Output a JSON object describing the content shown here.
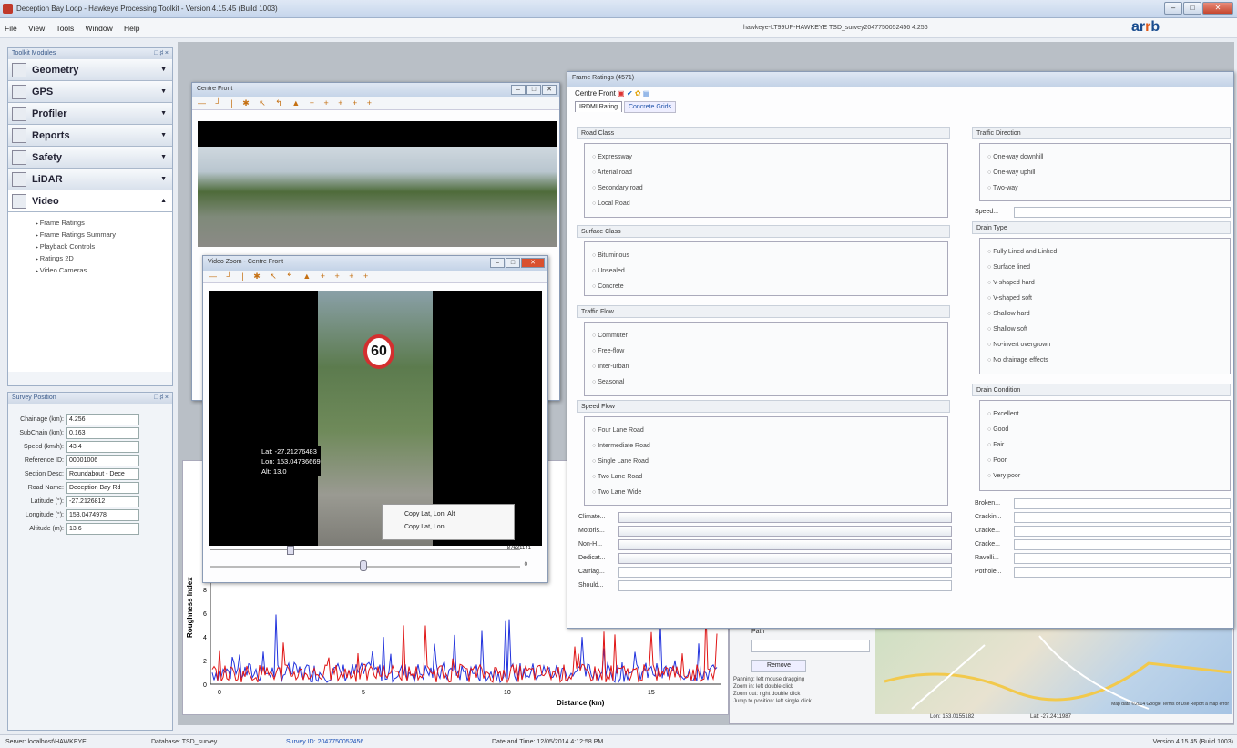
{
  "app": {
    "title": "Deception Bay Loop - Hawkeye Processing Toolkit - Version 4.15.45 (Build 1003)",
    "file_path": "hawkeye-LT99UP-HAWKEYE TSD_survey2047750052456 4.256",
    "logo_a": "ar",
    "logo_b": "r",
    "logo_c": "b"
  },
  "menu": [
    "File",
    "View",
    "Tools",
    "Window",
    "Help"
  ],
  "toolkit": {
    "title": "Toolkit Modules",
    "pins": "□ ♯ ×",
    "modules": [
      {
        "label": "Geometry",
        "icon": "geometry-icon"
      },
      {
        "label": "GPS",
        "icon": "gps-icon"
      },
      {
        "label": "Profiler",
        "icon": "profiler-icon"
      },
      {
        "label": "Reports",
        "icon": "reports-icon"
      },
      {
        "label": "Safety",
        "icon": "safety-icon"
      },
      {
        "label": "LiDAR",
        "icon": "lidar-icon"
      },
      {
        "label": "Video",
        "icon": "video-icon"
      }
    ],
    "video_items": [
      "Frame Ratings",
      "Frame Ratings Summary",
      "Playback Controls",
      "Ratings 2D",
      "Video Cameras"
    ]
  },
  "survey": {
    "title": "Survey Position",
    "pins": "□ ♯ ×",
    "fields": [
      {
        "k": "Chainage (km):",
        "v": "4.256"
      },
      {
        "k": "SubChain (km):",
        "v": "0.163"
      },
      {
        "k": "Speed (km/h):",
        "v": "43.4"
      },
      {
        "k": "Reference ID:",
        "v": "00001006"
      },
      {
        "k": "Section Desc:",
        "v": "Roundabout - Dece"
      },
      {
        "k": "Road Name:",
        "v": "Deception Bay Rd"
      },
      {
        "k": "Latitude (°):",
        "v": "-27.2126812"
      },
      {
        "k": "Longitude (°):",
        "v": "153.0474978"
      },
      {
        "k": "Altitude (m):",
        "v": "13.6"
      }
    ]
  },
  "centre_front": {
    "title": "Centre Front"
  },
  "zoom": {
    "title": "Video Zoom - Centre Front",
    "lat_label": "Lat:",
    "lat": "-27.21276483",
    "lon_label": "Lon:",
    "lon": "153.04736669",
    "alt_label": "Alt:",
    "alt": "13.0",
    "ctx": [
      "Copy Lat, Lon, Alt",
      "Copy Lat, Lon"
    ],
    "frame": "87631141",
    "zoomv": "0",
    "sign": "60"
  },
  "frame": {
    "title": "Frame Ratings (4571)",
    "camera": "Centre Front",
    "tabs": [
      "IRDMI Rating",
      "Concrete Grids"
    ],
    "road_class": {
      "title": "Road Class",
      "opts": [
        "Expressway",
        "Arterial road",
        "Secondary road",
        "Local Road"
      ]
    },
    "surface": {
      "title": "Surface Class",
      "opts": [
        "Bituminous",
        "Unsealed",
        "Concrete"
      ]
    },
    "traffic": {
      "title": "Traffic Flow",
      "opts": [
        "Commuter",
        "Free-flow",
        "Inter-urban",
        "Seasonal"
      ]
    },
    "speed": {
      "title": "Speed Flow",
      "opts": [
        "Four Lane Road",
        "Intermediate Road",
        "Single Lane Road",
        "Two Lane Road",
        "Two Lane Wide"
      ]
    },
    "direction": {
      "title": "Traffic Direction",
      "opts": [
        "One-way downhill",
        "One-way uphill",
        "Two-way"
      ],
      "speed_label": "Speed..."
    },
    "drain": {
      "title": "Drain Type",
      "opts": [
        "Fully Lined and Linked",
        "Surface lined",
        "V-shaped hard",
        "V-shaped soft",
        "Shallow hard",
        "Shallow soft",
        "No-invert overgrown",
        "No drainage effects"
      ]
    },
    "drain_cond": {
      "title": "Drain Condition",
      "opts": [
        "Excellent",
        "Good",
        "Fair",
        "Poor",
        "Very poor"
      ]
    },
    "dropdowns": [
      "Climate...",
      "Motoris...",
      "Non-H...",
      "Dedicat...",
      "Carriag...",
      "Should..."
    ],
    "right_fields": [
      "Broken...",
      "Crackin...",
      "Cracke...",
      "Cracke...",
      "Ravelli...",
      "Pothole..."
    ]
  },
  "chart": {
    "ylabel": "Roughness Index",
    "xlabel": "Distance (km)",
    "yticks": [
      "0",
      "2",
      "4",
      "6",
      "8"
    ],
    "xticks": [
      "0",
      "5",
      "10",
      "15"
    ]
  },
  "map": {
    "path_label": "Path",
    "remove": "Remove",
    "help": [
      [
        "Panning:",
        "left mouse dragging"
      ],
      [
        "Zoom in:",
        "left double click"
      ],
      [
        "Zoom out:",
        "right double click"
      ],
      [
        "Jump to position:",
        "left single click"
      ]
    ],
    "lon": "Lon: 153.0155182",
    "lat": "Lat: -27.2411987",
    "credit": "Map data ©2014 Google  Terms of Use  Report a map error"
  },
  "status": {
    "server": "Server: localhost\\HAWKEYE",
    "db": "Database: TSD_survey",
    "survey": "Survey ID: 2047750052456",
    "date": "Date and Time: 12/05/2014 4:12:58 PM",
    "version": "Version 4.15.45 (Build 1003)"
  }
}
